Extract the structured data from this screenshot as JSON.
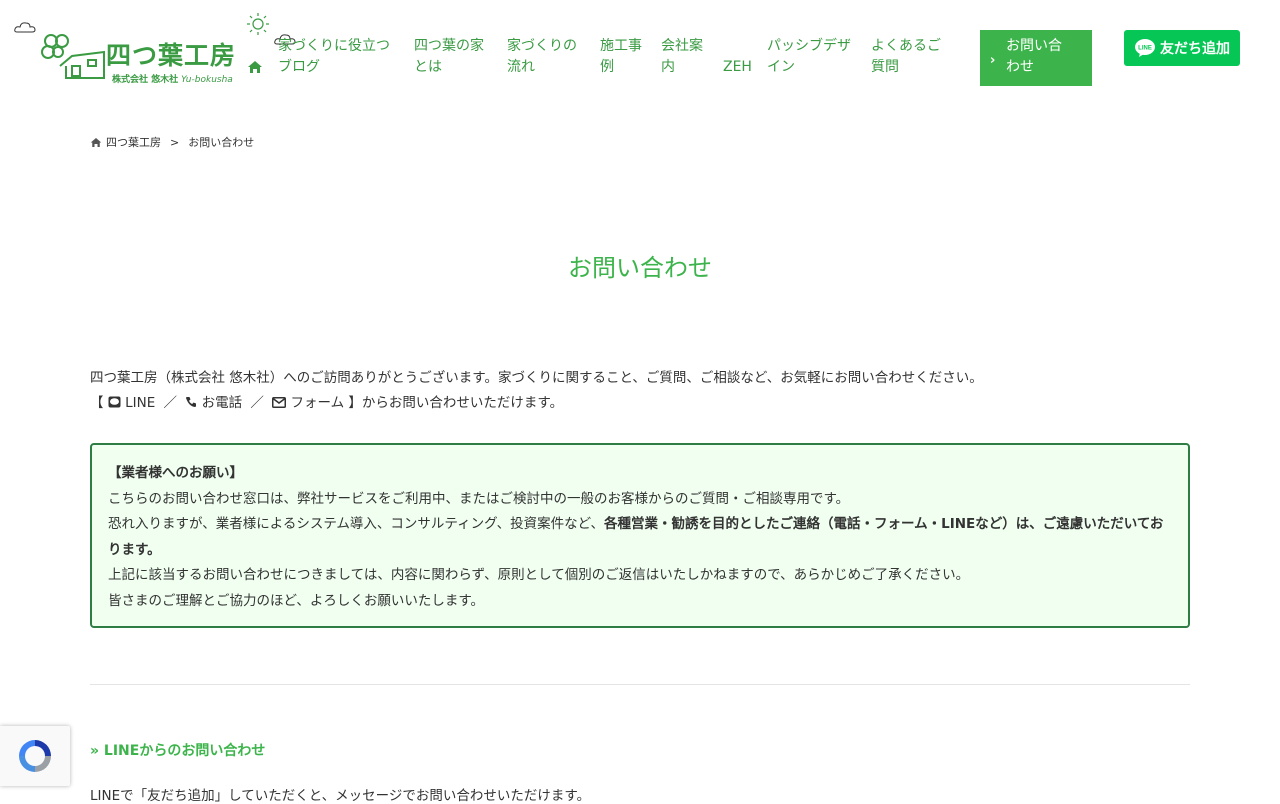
{
  "header": {
    "logo_title": "四つ葉工房",
    "logo_company": "株式会社 悠木社",
    "logo_romaji": "Yu-bokusha",
    "nav": [
      {
        "line1": "家づくりに役立つ",
        "line2": "ブログ"
      },
      {
        "line1": "四つ葉の家",
        "line2": "とは"
      },
      {
        "line1": "家づくりの",
        "line2": "流れ"
      },
      {
        "line1": "施工事",
        "line2": "例"
      },
      {
        "line1": "会社案",
        "line2": "内"
      },
      {
        "line1": "",
        "line2": "ZEH"
      },
      {
        "line1": "パッシブデザ",
        "line2": "イン"
      },
      {
        "line1": "よくあるご",
        "line2": "質問"
      }
    ],
    "contact": {
      "line1": "お問い合",
      "line2": "わせ"
    },
    "line_button": "友だち追加",
    "line_logo_text": "LINE"
  },
  "breadcrumb": {
    "home": "四つ葉工房",
    "separator": ">",
    "current": "お問い合わせ"
  },
  "page_title": "お問い合わせ",
  "intro": {
    "text": "四つ葉工房（株式会社 悠木社）へのご訪問ありがとうございます。家づくりに関すること、ご質問、ご相談など、お気軽にお問い合わせください。",
    "bracket_open": "【",
    "line": "LINE",
    "slash": "／",
    "phone": "お電話",
    "form": "フォーム",
    "bracket_close": "】からお問い合わせいただけます。"
  },
  "notice": {
    "head": "【業者様へのお願い】",
    "p1": "こちらのお問い合わせ窓口は、弊社サービスをご利用中、またはご検討中の一般のお客様からのご質問・ご相談専用です。",
    "p2_normal": "恐れ入りますが、業者様によるシステム導入、コンサルティング、投資案件など、",
    "p2_bold": "各種営業・勧誘を目的としたご連絡（電話・フォーム・LINEなど）は、ご遠慮いただいております。",
    "p3": "上記に該当するお問い合わせにつきましては、内容に関わらず、原則として個別のご返信はいたしかねますので、あらかじめご了承ください。",
    "p4": "皆さまのご理解とご協力のほど、よろしくお願いいたします。"
  },
  "line_section": {
    "heading": "» LINEからのお問い合わせ",
    "text": "LINEで「友だち追加」していただくと、メッセージでお問い合わせいただけます。"
  },
  "colors": {
    "brand_green": "#3a9b43",
    "accent_green": "#3cb44b",
    "line_green": "#06c755",
    "notice_border": "#2e7d45",
    "notice_bg": "#f0fff0"
  },
  "icons": [
    "home-icon",
    "chevron-right-icon",
    "line-icon",
    "phone-icon",
    "envelope-icon",
    "recaptcha-icon"
  ]
}
